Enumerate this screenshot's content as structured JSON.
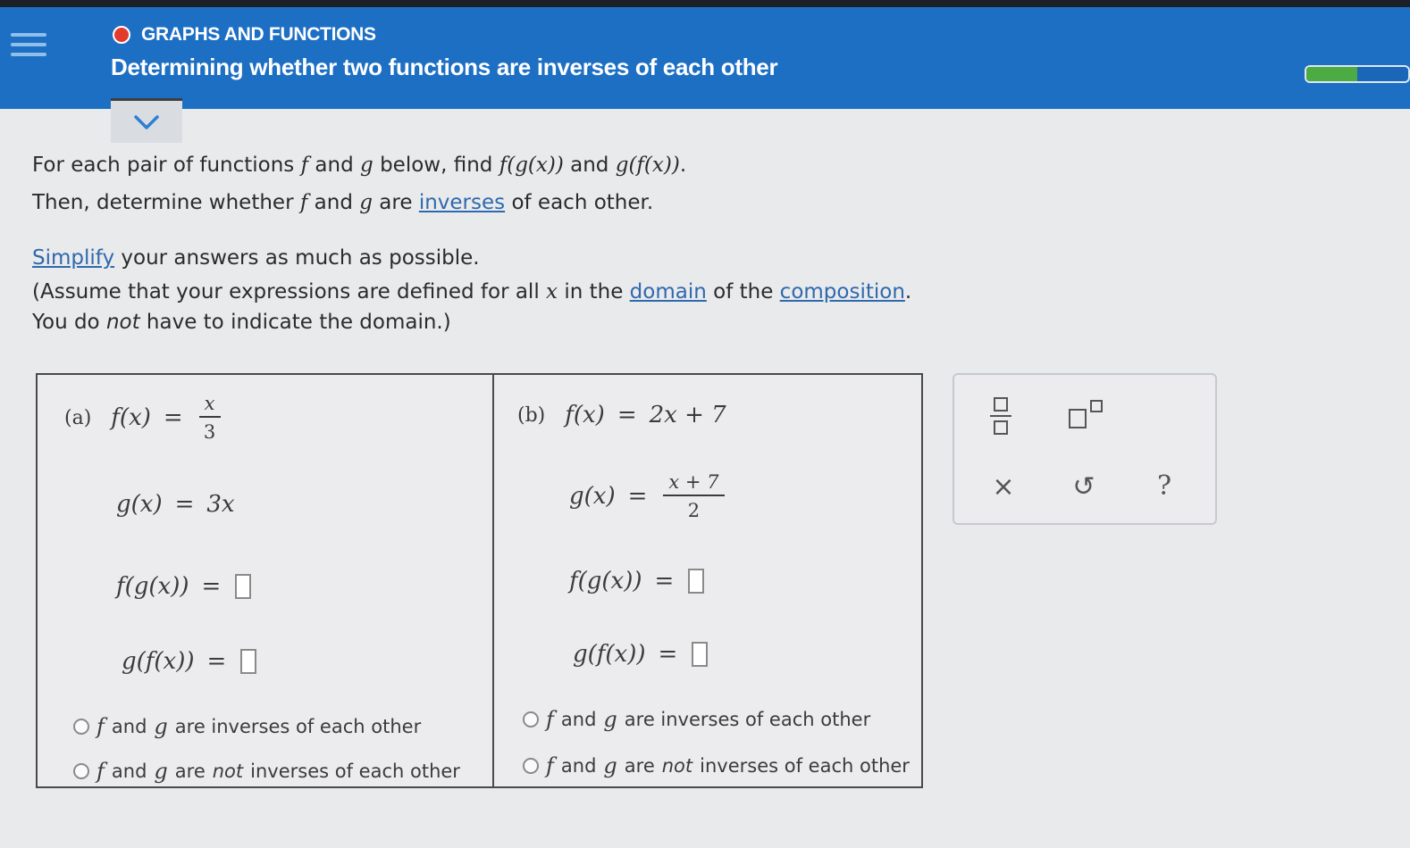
{
  "header": {
    "topic": "GRAPHS AND FUNCTIONS",
    "title": "Determining whether two functions are inverses of each other",
    "progress_fraction": 0.5,
    "accent_color": "#1d6fc4",
    "topic_dot_color": "#e23b2e",
    "progress_color": "#4cab43"
  },
  "instructions": {
    "l1_a": "For each pair of functions ",
    "f": "f",
    "and": " and ",
    "g": "g",
    "l1_b": " below, find ",
    "fog": "f(g(x))",
    "gof": "g(f(x))",
    "period": ".",
    "l2_a": "Then, determine whether ",
    "l2_are": " are ",
    "inverses_link": "inverses",
    "l2_b": " of each other.",
    "simplify_link": "Simplify",
    "l3": " your answers as much as possible.",
    "l4_a": "(Assume that your expressions are defined for all ",
    "x": "x",
    "l4_b": " in the ",
    "domain_link": "domain",
    "l4_c": " of the ",
    "composition_link": "composition",
    "l4_d": ".",
    "l5_a": "You do ",
    "l5_not": "not",
    "l5_b": " have to indicate the domain.)"
  },
  "problems": {
    "a": {
      "label": "(a)",
      "f_lhs": "f(x)",
      "f_num": "x",
      "f_den": "3",
      "g_lhs": "g(x)",
      "g_rhs": "3x",
      "fog_lhs": "f(g(x))",
      "gof_lhs": "g(f(x))"
    },
    "b": {
      "label": "(b)",
      "f_lhs": "f(x)",
      "f_rhs": "2x + 7",
      "g_lhs": "g(x)",
      "g_num": "x + 7",
      "g_den": "2",
      "fog_lhs": "f(g(x))",
      "gof_lhs": "g(f(x))"
    },
    "eq": "=",
    "options": {
      "f": "f",
      "and": " and ",
      "g": "g",
      "inverse_text": " are inverses of each other",
      "not_pre": " are ",
      "not_word": "not",
      "not_post": " inverses of each other"
    }
  },
  "tools": {
    "clear": "×",
    "undo": "↺",
    "help": "?"
  }
}
